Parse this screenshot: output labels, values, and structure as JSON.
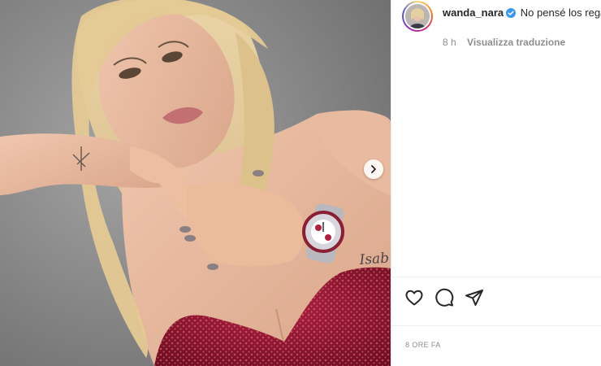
{
  "post": {
    "username": "wanda_nara",
    "caption": "No pensé los regalos que me acordaba que este fin de semana",
    "age": "8 h",
    "translate_label": "Visualizza traduzione",
    "timestamp": "8 ORE FA"
  },
  "image": {
    "tattoo_text": "Isab"
  },
  "icons": {
    "verified": "verified-badge-icon",
    "like": "heart-icon",
    "comment": "comment-icon",
    "share": "paper-plane-icon",
    "next": "chevron-right-icon"
  },
  "colors": {
    "verified_blue": "#3897f0",
    "muted_text": "#8e8e8e",
    "dress_red": "#8a1226"
  }
}
